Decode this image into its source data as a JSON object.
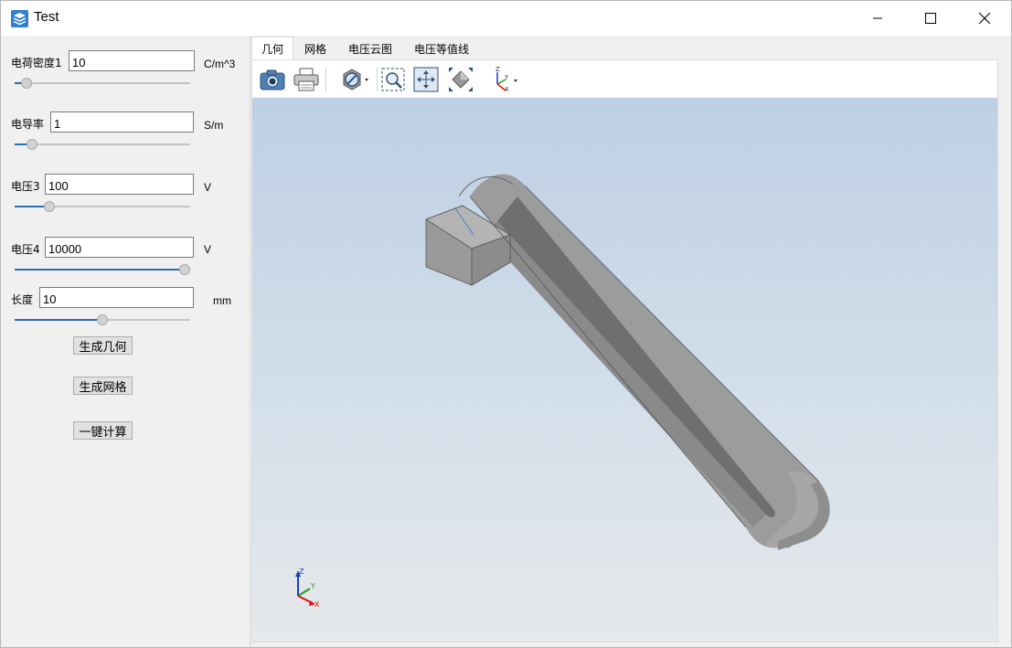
{
  "window": {
    "title": "Test"
  },
  "params": [
    {
      "label": "电荷密度1",
      "value": "10",
      "unit": "C/m^3",
      "slider": 0.07
    },
    {
      "label": "电导率",
      "value": "1",
      "unit": "S/m",
      "slider": 0.1
    },
    {
      "label": "电压3",
      "value": "100",
      "unit": "V",
      "slider": 0.2
    },
    {
      "label": "电压4",
      "value": "10000",
      "unit": "V",
      "slider": 1.0
    },
    {
      "label": "长度",
      "value": "10",
      "unit": "mm",
      "slider": 0.5
    }
  ],
  "actions": {
    "generate_geometry": "生成几何",
    "generate_mesh": "生成网格",
    "one_click_compute": "一键计算"
  },
  "tabs": [
    "几何",
    "网格",
    "电压云图",
    "电压等值线"
  ],
  "active_tab": 0,
  "toolbar": {
    "icons": [
      "camera-icon",
      "printer-icon",
      "visibility-icon",
      "zoom-window-icon",
      "fit-all-icon",
      "view-cube-icon",
      "axis-orientation-icon"
    ]
  },
  "triad": {
    "z": "Z",
    "y": "Y",
    "x": "X"
  },
  "colors": {
    "accent": "#2b6db8",
    "viewport_top": "#bed0e4",
    "viewport_bottom": "#e6e8ea",
    "model": "#8e8e8e"
  }
}
